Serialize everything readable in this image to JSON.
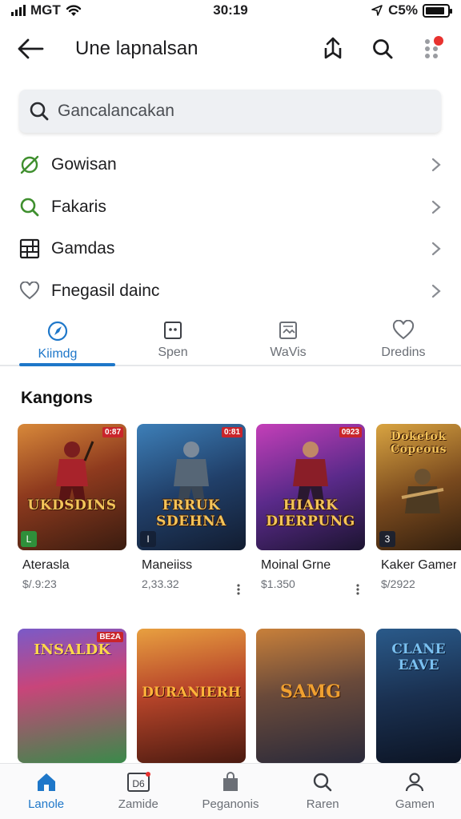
{
  "status": {
    "carrier": "MGT",
    "time": "30:19",
    "battery": "C5%",
    "battery_level": 0.9
  },
  "appbar": {
    "title": "Une lapnalsan"
  },
  "search": {
    "placeholder": "Gancalancakan"
  },
  "menu": [
    {
      "label": "Gowisan",
      "icon": "leaf-icon"
    },
    {
      "label": "Fakaris",
      "icon": "search-icon"
    },
    {
      "label": "Gamdas",
      "icon": "grid-icon"
    },
    {
      "label": "Fnegasil dainc",
      "icon": "heart-icon"
    }
  ],
  "tabs": [
    {
      "label": "Kiimdg",
      "icon": "compass-icon",
      "active": true
    },
    {
      "label": "Spen",
      "icon": "square-dots-icon",
      "active": false
    },
    {
      "label": "WaVis",
      "icon": "picture-icon",
      "active": false
    },
    {
      "label": "Dredins",
      "icon": "heart-icon",
      "active": false
    }
  ],
  "section": {
    "title": "Kangons"
  },
  "games": [
    {
      "name": "Aterasla",
      "price": "$/.9:23",
      "art_text": "UKDSDINS",
      "tag": "0:87",
      "corner": "L"
    },
    {
      "name": "Maneiiss",
      "price": "2,33.32",
      "art_text": "FRRUK SDEHNA",
      "tag": "0:81",
      "corner": "I"
    },
    {
      "name": "Moinal Grne",
      "price": "$1.350",
      "art_text": "HIARK DIERPUNG",
      "tag": "0923",
      "corner": ""
    },
    {
      "name": "Kaker Gamer",
      "price": "$/2922",
      "art_text": "Doketok Copeous",
      "tag": "",
      "corner": "3"
    }
  ],
  "games_row2": [
    {
      "art_text": "INSALDK",
      "tag": "BE2A"
    },
    {
      "art_text": "DURANIERH",
      "tag": ""
    },
    {
      "art_text": "SAMG",
      "tag": ""
    },
    {
      "art_text": "CLANE EAVE",
      "tag": ""
    }
  ],
  "bottomnav": [
    {
      "label": "Lanole",
      "icon": "home-icon",
      "active": true
    },
    {
      "label": "Zamide",
      "icon": "calendar-icon",
      "active": false
    },
    {
      "label": "Peganonis",
      "icon": "bag-icon",
      "active": false
    },
    {
      "label": "Raren",
      "icon": "search-icon",
      "active": false
    },
    {
      "label": "Gamen",
      "icon": "person-icon",
      "active": false
    }
  ],
  "colors": {
    "accent": "#1e77c9",
    "badge": "#e8322f",
    "leaf": "#3f8f2e"
  }
}
